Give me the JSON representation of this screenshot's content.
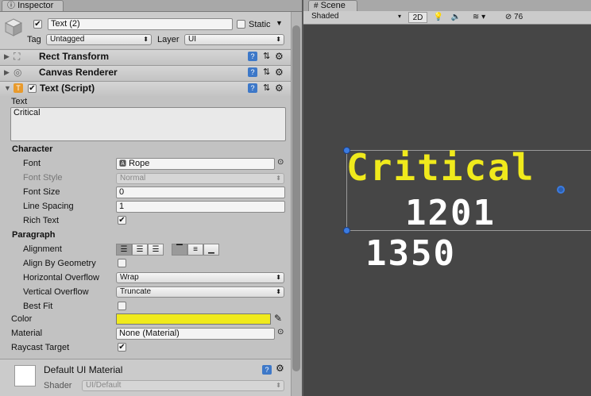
{
  "inspector": {
    "tab_label": "Inspector",
    "tab_icon": "info-icon",
    "object_name": "Text (2)",
    "static_label": "Static",
    "tag_label": "Tag",
    "tag_value": "Untagged",
    "layer_label": "Layer",
    "layer_value": "UI",
    "components": {
      "rect_transform": "Rect Transform",
      "canvas_renderer": "Canvas Renderer",
      "text_script": "Text (Script)"
    },
    "text_label": "Text",
    "text_value": "Critical",
    "character_header": "Character",
    "font_label": "Font",
    "font_value": "Rope",
    "font_style_label": "Font Style",
    "font_style_value": "Normal",
    "font_size_label": "Font Size",
    "font_size_value": "0",
    "line_spacing_label": "Line Spacing",
    "line_spacing_value": "1",
    "rich_text_label": "Rich Text",
    "paragraph_header": "Paragraph",
    "alignment_label": "Alignment",
    "align_geometry_label": "Align By Geometry",
    "h_overflow_label": "Horizontal Overflow",
    "h_overflow_value": "Wrap",
    "v_overflow_label": "Vertical Overflow",
    "v_overflow_value": "Truncate",
    "best_fit_label": "Best Fit",
    "color_label": "Color",
    "color_value": "#f0ea1c",
    "material_label": "Material",
    "material_value": "None (Material)",
    "raycast_label": "Raycast Target",
    "material_section_title": "Default UI Material",
    "shader_label": "Shader",
    "shader_value": "UI/Default"
  },
  "scene": {
    "tab_label": "Scene",
    "shading_value": "Shaded",
    "mode_2d": "2D",
    "gizmo_count": "76",
    "texts": {
      "critical": "Critical",
      "num1": "1201",
      "num2": "1350"
    },
    "critical_color": "#f0ea1c"
  }
}
